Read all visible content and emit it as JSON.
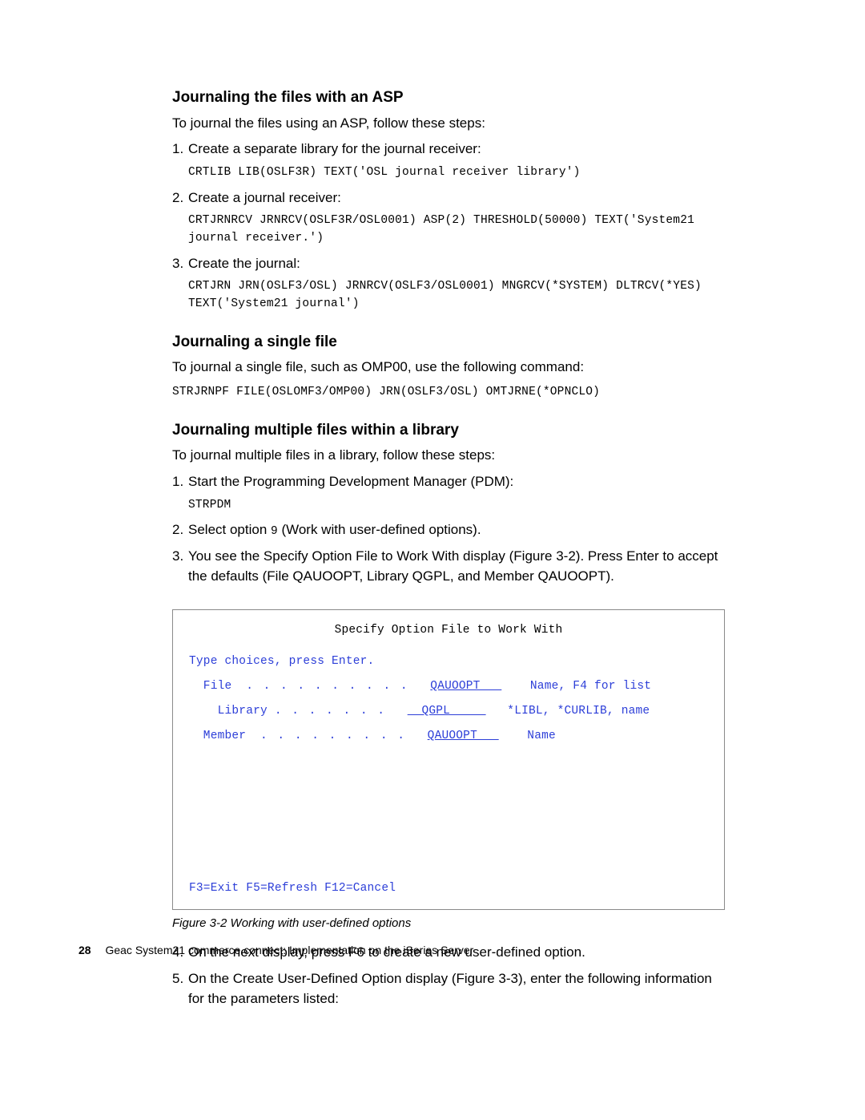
{
  "section1": {
    "heading": "Journaling the files with an ASP",
    "intro": "To journal the files using an ASP, follow these steps:",
    "steps": [
      {
        "text": "Create a separate library for the journal receiver:",
        "code": "CRTLIB LIB(OSLF3R) TEXT('OSL journal receiver library')"
      },
      {
        "text": "Create a journal receiver:",
        "code": "CRTJRNRCV JRNRCV(OSLF3R/OSL0001) ASP(2) THRESHOLD(50000) TEXT('System21 journal receiver.')"
      },
      {
        "text": "Create the journal:",
        "code": "CRTJRN JRN(OSLF3/OSL) JRNRCV(OSLF3/OSL0001) MNGRCV(*SYSTEM) DLTRCV(*YES) TEXT('System21 journal')"
      }
    ]
  },
  "section2": {
    "heading": "Journaling a single file",
    "intro": "To journal a single file, such as OMP00, use the following command:",
    "code": "STRJRNPF FILE(OSLOMF3/OMP00) JRN(OSLF3/OSL) OMTJRNE(*OPNCLO)"
  },
  "section3": {
    "heading": "Journaling multiple files within a library",
    "intro": "To journal multiple files in a library, follow these steps:",
    "steps123": [
      {
        "text": "Start the Programming Development Manager (PDM):",
        "code": "STRPDM"
      },
      {
        "text": "Select option 9 (Work with user-defined options).",
        "code": ""
      },
      {
        "text": "You see the Specify Option File to Work With display (Figure 3-2). Press Enter to accept the defaults (File QAUOOPT, Library QGPL, and Member QAUOOPT).",
        "code": ""
      }
    ],
    "steps45": [
      {
        "marker": "4.",
        "text": "On the next display, press F6 to create a new user-defined option."
      },
      {
        "marker": "5.",
        "text": "On the Create User-Defined Option display (Figure 3-3), enter the following information for the parameters listed:"
      }
    ]
  },
  "terminal": {
    "title": "Specify Option File to Work With",
    "prompt": "Type choices, press Enter.",
    "rows": [
      {
        "label": "  File  ",
        "dots": ". . . . . . . . . .",
        "value": "QAUOOPT   ",
        "hint": "    Name, F4 for list"
      },
      {
        "label": "    Library ",
        "dots": ". . . . . . .",
        "value": "  QGPL     ",
        "hint": "   *LIBL, *CURLIB, name"
      },
      {
        "label": "  Member  ",
        "dots": ". . . . . . . . .",
        "value": "QAUOOPT   ",
        "hint": "    Name"
      }
    ],
    "fkeys": "F3=Exit     F5=Refresh     F12=Cancel"
  },
  "figcap": "Figure 3-2   Working with user-defined options",
  "footer": {
    "page": "28",
    "title": "Geac System21 commerce.connect: Implementation on the iSeries Server"
  }
}
